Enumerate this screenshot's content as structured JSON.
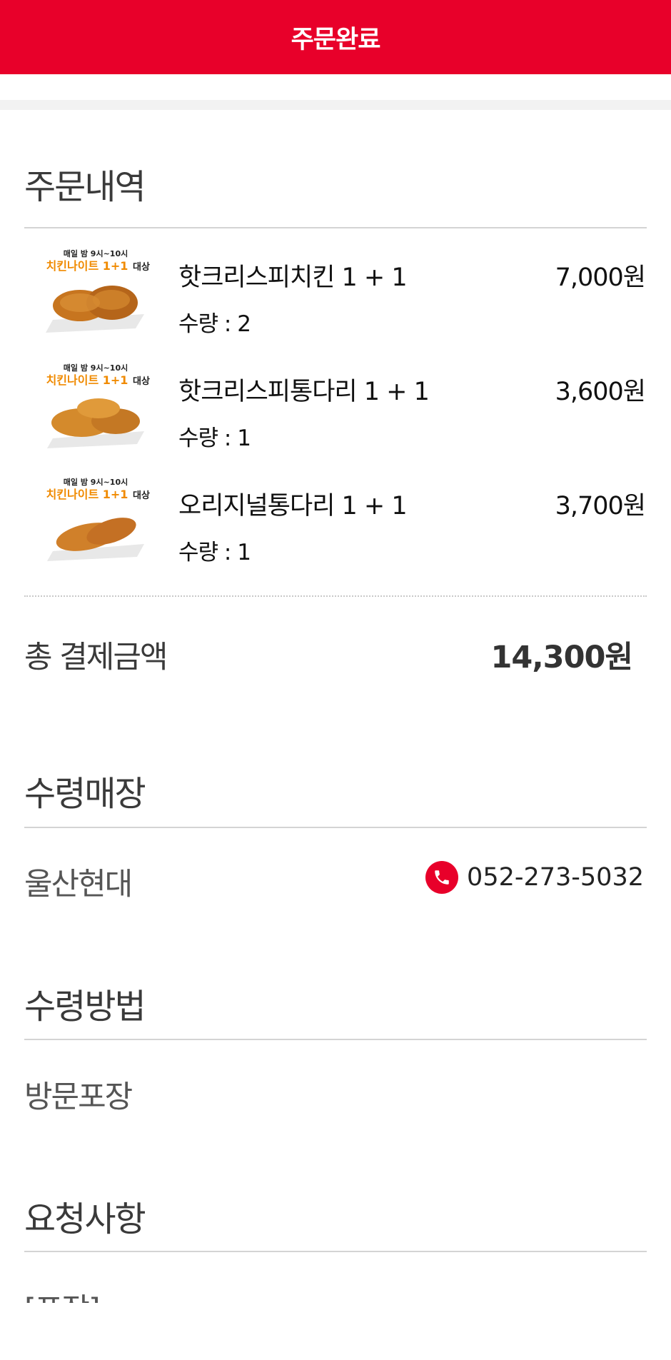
{
  "header": {
    "title": "주문완료"
  },
  "order": {
    "title": "주문내역",
    "items": [
      {
        "promo_top": "매일 밤 9시~10시",
        "promo_main": "치킨나이트 1+1",
        "promo_tag": "대상",
        "name": "핫크리스피치킨 1 + 1",
        "qty": "수량 : 2",
        "price": "7,000원"
      },
      {
        "promo_top": "매일 밤 9시~10시",
        "promo_main": "치킨나이트 1+1",
        "promo_tag": "대상",
        "name": "핫크리스피통다리 1 + 1",
        "qty": "수량 : 1",
        "price": "3,600원"
      },
      {
        "promo_top": "매일 밤 9시~10시",
        "promo_main": "치킨나이트 1+1",
        "promo_tag": "대상",
        "name": "오리지널통다리 1 + 1",
        "qty": "수량 : 1",
        "price": "3,700원"
      }
    ],
    "total_label": "총 결제금액",
    "total_value": "14,300원"
  },
  "store": {
    "title": "수령매장",
    "name": "울산현대",
    "phone": "052-273-5032",
    "phone_icon": "phone-icon"
  },
  "method": {
    "title": "수령방법",
    "value": "방문포장"
  },
  "request": {
    "title": "요청사항",
    "value": "[포장]"
  },
  "colors": {
    "brand": "#e8002a",
    "promo_orange": "#f08a00"
  }
}
